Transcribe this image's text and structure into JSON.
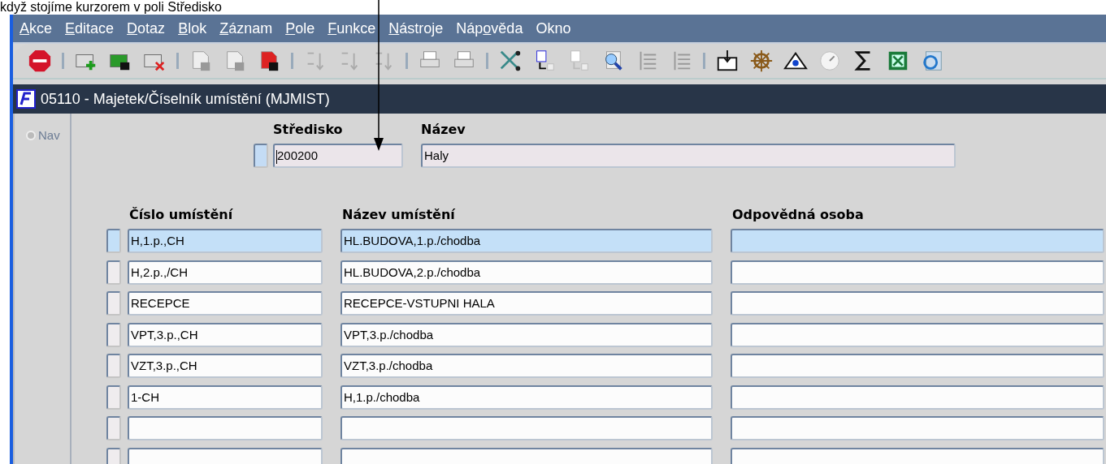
{
  "caption": "když stojíme kurzorem v poli Středisko",
  "menu": [
    {
      "key": "A",
      "after": "kce"
    },
    {
      "key": "E",
      "after": "ditace"
    },
    {
      "key": "D",
      "after": "otaz"
    },
    {
      "key": "B",
      "after": "lok"
    },
    {
      "key": "Z",
      "after": "áznam"
    },
    {
      "key": "P",
      "after": "ole"
    },
    {
      "key": "F",
      "after": "unkce"
    },
    {
      "key": "N",
      "after": "ástroje"
    },
    {
      "before": "Náp",
      "key": "o",
      "after": "věda"
    },
    {
      "after": "Okno"
    }
  ],
  "window": {
    "title": "05110 - Majetek/Číselník umístění (MJMIST)"
  },
  "nav": {
    "label": "Nav",
    "selected": false
  },
  "header": {
    "fields": [
      {
        "label": "Středisko",
        "value": "200200"
      },
      {
        "label": "Název",
        "value": "Haly"
      }
    ]
  },
  "table": {
    "columns": [
      "Číslo umístění",
      "Název umístění",
      "Odpovědná osoba"
    ],
    "rows": [
      {
        "selected": true,
        "cells": [
          "H,1.p.,CH",
          "HL.BUDOVA,1.p./chodba",
          ""
        ]
      },
      {
        "selected": false,
        "cells": [
          "H,2.p.,/CH",
          "HL.BUDOVA,2.p./chodba",
          ""
        ]
      },
      {
        "selected": false,
        "cells": [
          "RECEPCE",
          "RECEPCE-VSTUPNI HALA",
          ""
        ]
      },
      {
        "selected": false,
        "cells": [
          "VPT,3.p.,CH",
          "VPT,3.p./chodba",
          ""
        ]
      },
      {
        "selected": false,
        "cells": [
          "VZT,3.p.,CH",
          "VZT,3.p./chodba",
          ""
        ]
      },
      {
        "selected": false,
        "cells": [
          "1-CH",
          "H,1.p./chodba",
          ""
        ]
      },
      {
        "selected": false,
        "cells": [
          "",
          "",
          ""
        ]
      },
      {
        "selected": false,
        "cells": [
          "",
          "",
          ""
        ]
      }
    ]
  }
}
